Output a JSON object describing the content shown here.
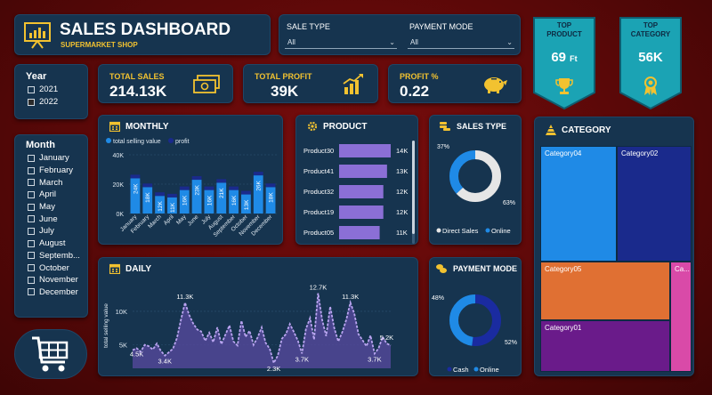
{
  "header": {
    "title": "SALES DASHBOARD",
    "subtitle": "SUPERMARKET SHOP"
  },
  "filters": {
    "sale_type_label": "SALE TYPE",
    "sale_type_value": "All",
    "payment_mode_label": "PAYMENT MODE",
    "payment_mode_value": "All"
  },
  "ribbons": {
    "top_product_label_1": "TOP",
    "top_product_label_2": "PRODUCT",
    "top_product_value": "69",
    "top_product_unit": "Ft",
    "top_category_label_1": "TOP",
    "top_category_label_2": "CATEGORY",
    "top_category_value": "56K"
  },
  "year_slicer": {
    "title": "Year",
    "items": [
      {
        "label": "2021",
        "checked": false
      },
      {
        "label": "2022",
        "checked": true
      }
    ]
  },
  "kpis": {
    "total_sales_label": "TOTAL SALES",
    "total_sales_value": "214.13K",
    "total_profit_label": "TOTAL PROFIT",
    "total_profit_value": "39K",
    "profit_pct_label": "PROFIT %",
    "profit_pct_value": "0.22"
  },
  "month_slicer": {
    "title": "Month",
    "items": [
      "January",
      "February",
      "March",
      "April",
      "May",
      "June",
      "July",
      "August",
      "Septemb...",
      "October",
      "November",
      "December"
    ]
  },
  "monthly_card": {
    "title": "MONTHLY"
  },
  "product_card": {
    "title": "PRODUCT"
  },
  "sales_type_card": {
    "title": "SALES TYPE"
  },
  "daily_card": {
    "title": "DAILY"
  },
  "payment_mode_card": {
    "title": "PAYMENT MODE"
  },
  "category_card": {
    "title": "CATEGORY"
  },
  "colors": {
    "accent": "#f2c230",
    "card": "#16344f",
    "bar_primary": "#1f8ae6",
    "bar_dark": "#1a2a8c",
    "product_bar": "#8b6fd6",
    "donut_blue": "#1f8ae6",
    "donut_navy": "#1a2ba0",
    "ribbon": "#1ba3b4"
  },
  "chart_data": [
    {
      "type": "bar",
      "name": "monthly",
      "legend": [
        "total selling value",
        "profit"
      ],
      "categories": [
        "January",
        "February",
        "March",
        "April",
        "May",
        "June",
        "July",
        "August",
        "September",
        "October",
        "November",
        "December"
      ],
      "series": [
        {
          "name": "total selling value",
          "values": [
            24,
            18,
            12,
            11,
            16,
            23,
            16,
            21,
            16,
            13,
            26,
            18
          ]
        },
        {
          "name": "profit",
          "values": [
            4,
            3,
            2,
            2,
            3,
            4,
            3,
            4,
            3,
            2,
            5,
            3
          ]
        }
      ],
      "data_labels": [
        "24K",
        "18K",
        "12K",
        "11K",
        "16K",
        "23K",
        "16K",
        "21K",
        "16K",
        "13K",
        "26K",
        "18K"
      ],
      "y_ticks": [
        "0K",
        "20K",
        "40K"
      ],
      "ylim": [
        0,
        40
      ]
    },
    {
      "type": "bar",
      "name": "product",
      "orientation": "horizontal",
      "categories": [
        "Product30",
        "Product41",
        "Product32",
        "Product19",
        "Product05"
      ],
      "values": [
        14,
        13,
        12,
        12,
        11
      ],
      "data_labels": [
        "14K",
        "13K",
        "12K",
        "12K",
        "11K"
      ]
    },
    {
      "type": "pie",
      "name": "sales type",
      "donut": true,
      "slices": [
        {
          "label": "Direct Sales",
          "value": 63,
          "color": "#e6e6e6"
        },
        {
          "label": "Online",
          "value": 37,
          "color": "#1f8ae6"
        }
      ],
      "data_labels": [
        "37%",
        "63%"
      ]
    },
    {
      "type": "area",
      "name": "daily",
      "ylabel": "total selling value",
      "y_ticks": [
        "5K",
        "10K"
      ],
      "ylim": [
        1.5,
        14.5
      ],
      "values": [
        4.2,
        4.5,
        4.0,
        5.0,
        4.8,
        4.3,
        5.2,
        4.1,
        3.4,
        3.9,
        4.4,
        6.0,
        8.8,
        11.3,
        9.5,
        8.2,
        7.3,
        7.0,
        5.6,
        6.8,
        5.4,
        7.6,
        5.1,
        6.5,
        7.9,
        5.5,
        4.9,
        8.6,
        6.2,
        7.1,
        5.0,
        6.1,
        7.6,
        5.3,
        4.4,
        2.3,
        3.4,
        5.9,
        6.6,
        8.1,
        6.9,
        5.6,
        3.7,
        7.4,
        9.0,
        5.8,
        12.7,
        8.7,
        6.3,
        10.7,
        7.5,
        5.5,
        6.9,
        8.8,
        11.3,
        9.6,
        6.6,
        5.7,
        4.8,
        6.4,
        3.7,
        4.5,
        6.2,
        5.2,
        4.9
      ],
      "point_labels": [
        {
          "index": 1,
          "text": "4.5K"
        },
        {
          "index": 8,
          "text": "3.4K"
        },
        {
          "index": 13,
          "text": "11.3K"
        },
        {
          "index": 35,
          "text": "2.3K"
        },
        {
          "index": 42,
          "text": "3.7K"
        },
        {
          "index": 46,
          "text": "12.7K"
        },
        {
          "index": 54,
          "text": "11.3K"
        },
        {
          "index": 60,
          "text": "3.7K"
        },
        {
          "index": 63,
          "text": "5.2K"
        }
      ]
    },
    {
      "type": "pie",
      "name": "payment mode",
      "donut": true,
      "slices": [
        {
          "label": "Cash",
          "value": 52,
          "color": "#1a2ba0"
        },
        {
          "label": "Online",
          "value": 48,
          "color": "#1f8ae6"
        }
      ],
      "data_labels": [
        "48%",
        "52%"
      ]
    },
    {
      "type": "heatmap",
      "name": "category treemap",
      "cells": [
        {
          "label": "Category04",
          "color": "#1f8ae6"
        },
        {
          "label": "Category02",
          "color": "#1a2a8c"
        },
        {
          "label": "Category05",
          "color": "#e07033"
        },
        {
          "label": "Category01",
          "color": "#6a1b8a"
        },
        {
          "label": "Ca...",
          "color": "#d94aa8"
        }
      ]
    }
  ]
}
